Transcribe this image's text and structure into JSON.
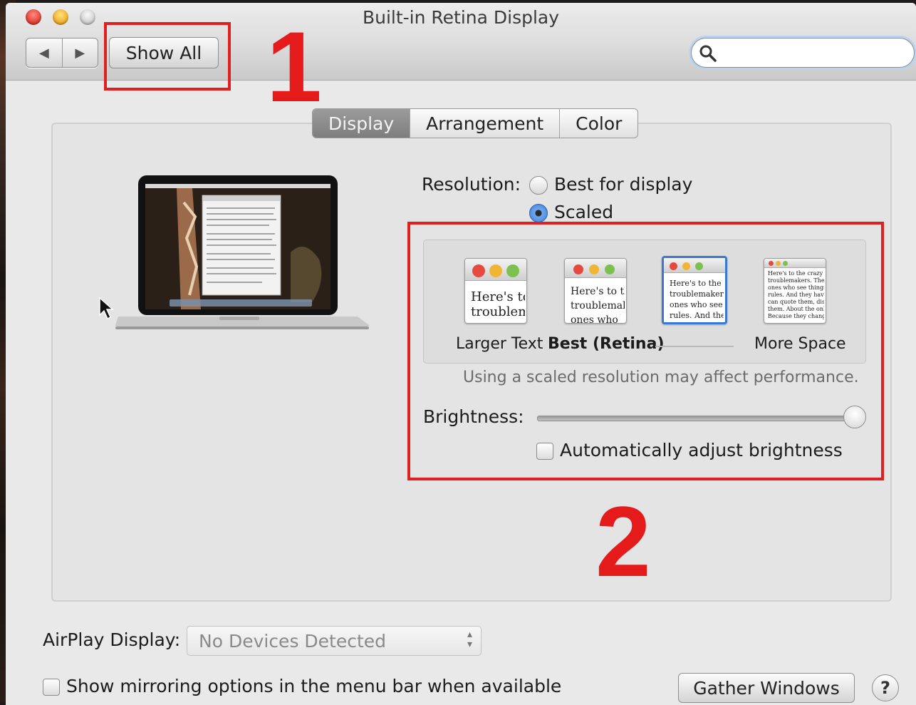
{
  "window": {
    "title": "Built-in Retina Display"
  },
  "toolbar": {
    "back_glyph": "◀",
    "forward_glyph": "▶",
    "show_all_label": "Show All",
    "search_value": ""
  },
  "annotations": {
    "marker_1": "1",
    "marker_2": "2",
    "highlight_color": "#e02020"
  },
  "tabs": [
    {
      "label": "Display",
      "active": true
    },
    {
      "label": "Arrangement",
      "active": false
    },
    {
      "label": "Color",
      "active": false
    }
  ],
  "resolution": {
    "label": "Resolution:",
    "options": [
      {
        "label": "Best for display",
        "selected": false
      },
      {
        "label": "Scaled",
        "selected": true
      }
    ]
  },
  "scaled": {
    "thumbnails": [
      {
        "text_lines": [
          "Here's to",
          "troublem"
        ],
        "label": "Larger Text",
        "selected": false
      },
      {
        "text_lines": [
          "Here's to th",
          "troublemak",
          "ones who"
        ],
        "label": "Best (Retina)",
        "selected": false
      },
      {
        "text_lines": [
          "Here's to the c",
          "troublemakers.",
          "ones who see t",
          "rules. And they"
        ],
        "label": "",
        "selected": true
      },
      {
        "text_lines": [
          "Here's to the crazy one",
          "troublemakers. The rou",
          "ones who see things di",
          "rules. And they have no",
          "can quote them, disagr",
          "them. About the only t",
          "Because they change th"
        ],
        "label": "More Space",
        "selected": false
      }
    ],
    "note": "Using a scaled resolution may affect performance."
  },
  "brightness": {
    "label": "Brightness:",
    "level": 0.97,
    "auto_label": "Automatically adjust brightness",
    "auto_checked": false
  },
  "airplay": {
    "label": "AirPlay Display:",
    "value": "No Devices Detected"
  },
  "mirroring": {
    "label": "Show mirroring options in the menu bar when available",
    "checked": false
  },
  "gather_label": "Gather Windows",
  "help_label": "?"
}
